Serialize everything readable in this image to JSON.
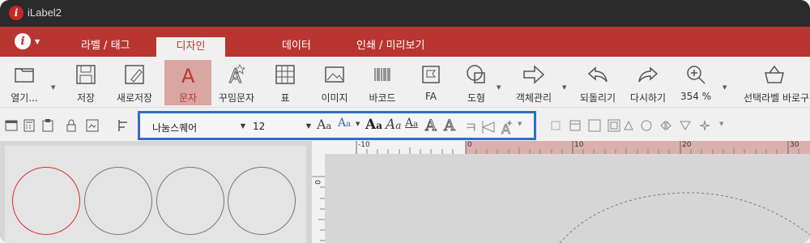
{
  "app": {
    "title": "iLabel2"
  },
  "tabs": [
    {
      "label": "라벨 / 태그"
    },
    {
      "label": "디자인"
    },
    {
      "label": "데이터"
    },
    {
      "label": "인쇄 / 미리보기"
    }
  ],
  "ribbon": {
    "open": "열기...",
    "save": "저장",
    "save_as": "새로저장",
    "text": "문자",
    "fancy_text": "꾸밈문자",
    "table": "표",
    "image": "이미지",
    "barcode": "바코드",
    "fa": "FA",
    "shape": "도형",
    "object_manage": "객체관리",
    "undo": "되돌리기",
    "redo": "다시하기",
    "zoom": "354 %",
    "select_label": "선택라벨 바로구"
  },
  "font": {
    "name": "나눔스퀘어",
    "size": "12"
  },
  "ruler": {
    "labels": [
      "-10",
      "0",
      "10",
      "20",
      "30"
    ],
    "v_label": "0"
  },
  "colors": {
    "accent": "#b8362f",
    "highlight": "#2f6fc3"
  }
}
